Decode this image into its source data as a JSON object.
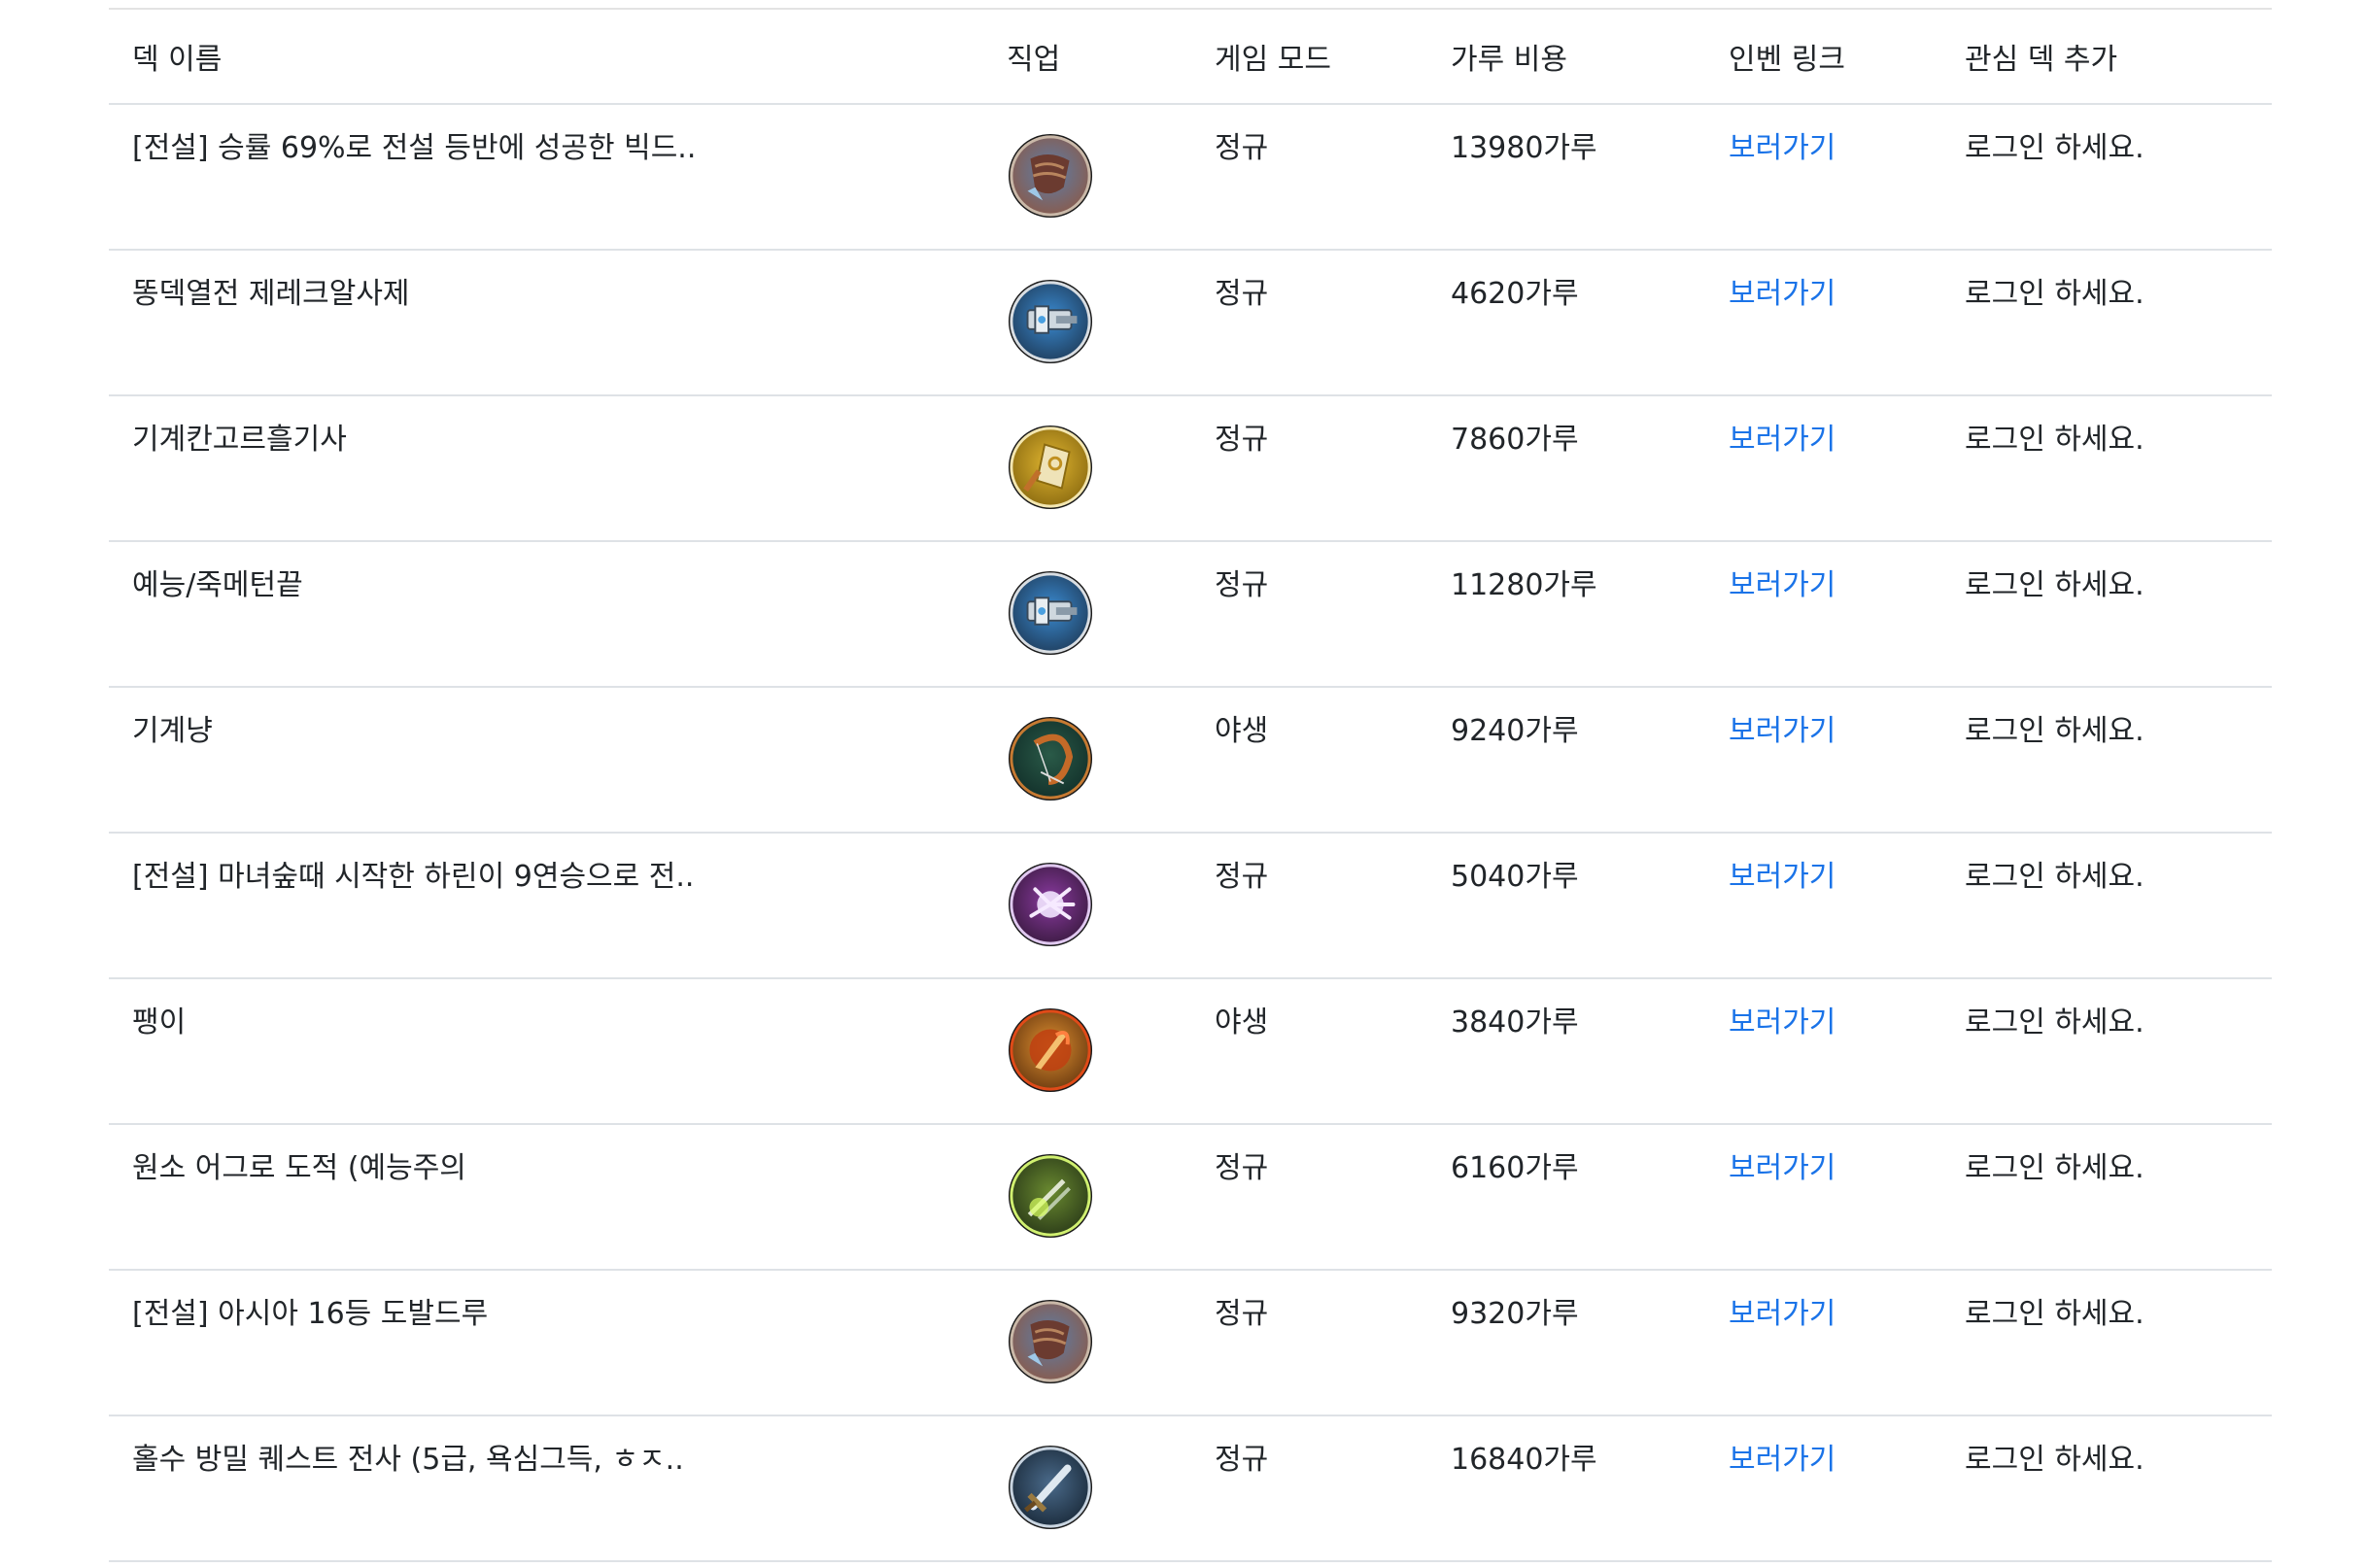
{
  "table": {
    "headers": {
      "name": "덱 이름",
      "class": "직업",
      "mode": "게임 모드",
      "cost": "가루 비용",
      "link": "인벤 링크",
      "fav": "관심 덱 추가"
    },
    "rows": [
      {
        "name": "[전설] 승률 69%로 전설 등반에 성공한 빅드..",
        "class_icon": "druid-claw-icon",
        "mode": "정규",
        "cost": "13980가루",
        "link": "보러가기",
        "fav": "로그인 하세요."
      },
      {
        "name": "똥덱열전 제레크알사제",
        "class_icon": "paladin-hammer-icon",
        "mode": "정규",
        "cost": "4620가루",
        "link": "보러가기",
        "fav": "로그인 하세요."
      },
      {
        "name": "기계칸고르흘기사",
        "class_icon": "priest-book-icon",
        "mode": "정규",
        "cost": "7860가루",
        "link": "보러가기",
        "fav": "로그인 하세요."
      },
      {
        "name": "예능/죽메턴끝",
        "class_icon": "paladin-hammer-icon",
        "mode": "정규",
        "cost": "11280가루",
        "link": "보러가기",
        "fav": "로그인 하세요."
      },
      {
        "name": "기계냥",
        "class_icon": "hunter-bow-icon",
        "mode": "야생",
        "cost": "9240가루",
        "link": "보러가기",
        "fav": "로그인 하세요."
      },
      {
        "name": "[전설] 마녀숲때 시작한 하린이 9연승으로 전..",
        "class_icon": "mage-hand-icon",
        "mode": "정규",
        "cost": "5040가루",
        "link": "보러가기",
        "fav": "로그인 하세요."
      },
      {
        "name": "팽이",
        "class_icon": "warlock-fire-icon",
        "mode": "야생",
        "cost": "3840가루",
        "link": "보러가기",
        "fav": "로그인 하세요."
      },
      {
        "name": "원소 어그로 도적 (예능주의",
        "class_icon": "rogue-daggers-icon",
        "mode": "정규",
        "cost": "6160가루",
        "link": "보러가기",
        "fav": "로그인 하세요."
      },
      {
        "name": "[전설] 아시아 16등 도발드루",
        "class_icon": "druid-claw-icon",
        "mode": "정규",
        "cost": "9320가루",
        "link": "보러가기",
        "fav": "로그인 하세요."
      },
      {
        "name": "홀수 방밀 퀘스트 전사 (5급, 욕심그득, ㅎㅈ..",
        "class_icon": "warrior-sword-icon",
        "mode": "정규",
        "cost": "16840가루",
        "link": "보러가기",
        "fav": "로그인 하세요."
      }
    ]
  },
  "colors": {
    "link": "#1a73e8",
    "border": "#dee2e6",
    "text": "#212529"
  }
}
